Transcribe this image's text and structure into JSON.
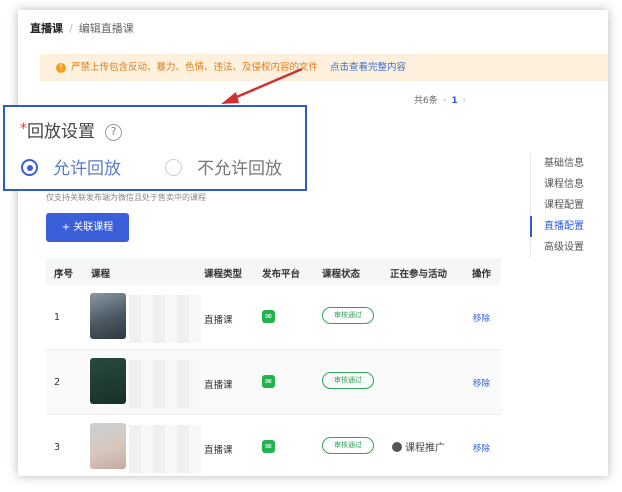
{
  "breadcrumb": {
    "root": "直播课",
    "separator": "/",
    "current": "编辑直播课"
  },
  "notice": {
    "text": "严禁上传包含反动、暴力、色情、违法、及侵权内容的文件",
    "link": "点击查看完整内容",
    "color": "#e07e1e"
  },
  "pager": {
    "total": "共6条",
    "prev": "‹",
    "current": "1",
    "next": "›"
  },
  "playback": {
    "required_mark": "*",
    "title": "回放设置",
    "help_icon": "?",
    "options": [
      {
        "label": "允许回放",
        "selected": true
      },
      {
        "label": "不允许回放",
        "selected": false
      }
    ]
  },
  "hint": "仅支持关联发布端为微信且处于售卖中的课程",
  "associate_button": "+ 关联课程",
  "side_nav": {
    "items": [
      "基础信息",
      "课程信息",
      "课程配置",
      "直播配置",
      "高级设置"
    ],
    "active_index": 3
  },
  "table": {
    "columns": [
      "序号",
      "课程",
      "课程类型",
      "发布平台",
      "课程状态",
      "正在参与活动",
      "操作"
    ],
    "rows": [
      {
        "index": "1",
        "type": "直播课",
        "platform_icon": "wechat-icon",
        "status": "审核通过",
        "activity": "",
        "action": "移除"
      },
      {
        "index": "2",
        "type": "直播课",
        "platform_icon": "wechat-icon",
        "status": "审核通过",
        "activity": "",
        "action": "移除"
      },
      {
        "index": "3",
        "type": "直播课",
        "platform_icon": "wechat-icon",
        "status": "审核通过",
        "activity": "课程推广",
        "action": "移除"
      }
    ]
  },
  "colors": {
    "accent": "#2f5bd8",
    "status_green": "#2ea65a",
    "callout_border": "#2f5bc0",
    "arrow": "#d0312d"
  }
}
